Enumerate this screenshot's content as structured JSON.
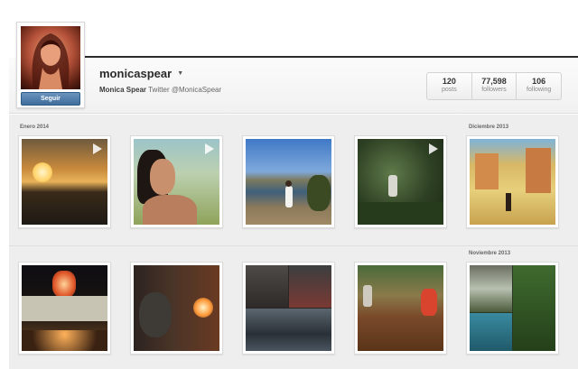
{
  "profile": {
    "username": "monicaspear",
    "full_name": "Monica Spear",
    "twitter_text": "Twitter @MonicaSpear",
    "follow_label": "Seguir"
  },
  "stats": [
    {
      "value": "120",
      "label": "posts"
    },
    {
      "value": "77,598",
      "label": "followers"
    },
    {
      "value": "106",
      "label": "following"
    }
  ],
  "months": {
    "enero_2014": "Enero 2014",
    "diciembre_2013": "Diciembre 2013",
    "noviembre_2013": "Noviembre 2013"
  },
  "photos": [
    {
      "id": "sunset",
      "video": true
    },
    {
      "id": "woman-field",
      "video": true
    },
    {
      "id": "lake-woman",
      "video": false
    },
    {
      "id": "jungle-zipline",
      "video": true
    },
    {
      "id": "colonial-street-painting",
      "video": false
    },
    {
      "id": "lantern-church",
      "video": false
    },
    {
      "id": "candle-portrait",
      "video": false
    },
    {
      "id": "collage-dusk",
      "video": false
    },
    {
      "id": "wooden-deck",
      "video": false
    },
    {
      "id": "waterfall-collage",
      "video": false
    }
  ]
}
